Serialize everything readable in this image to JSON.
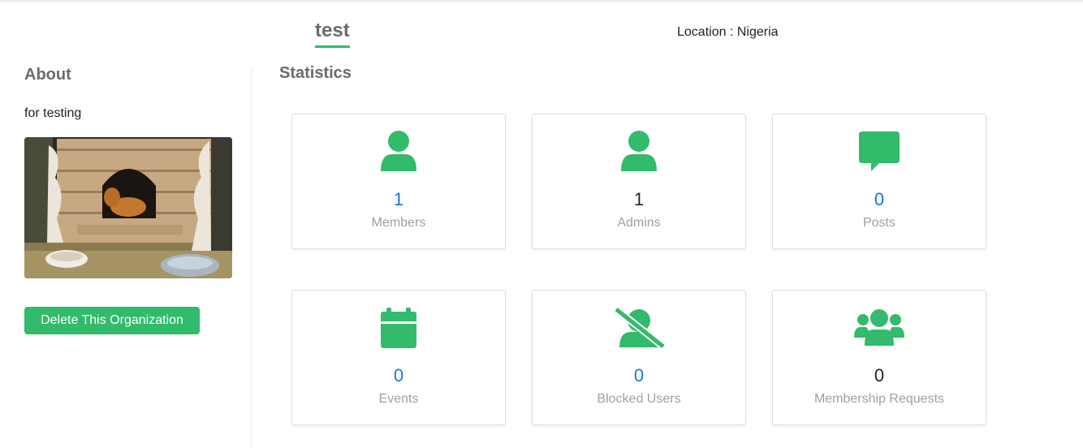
{
  "header": {
    "org_name": "test",
    "location": "Location : Nigeria"
  },
  "about": {
    "heading": "About",
    "description": "for testing",
    "delete_button": "Delete This Organization"
  },
  "statistics": {
    "heading": "Statistics",
    "cards": [
      {
        "icon": "user-icon",
        "value": "1",
        "label": "Members"
      },
      {
        "icon": "user-icon",
        "value": "1",
        "label": "Admins"
      },
      {
        "icon": "comment-icon",
        "value": "0",
        "label": "Posts"
      },
      {
        "icon": "calendar-icon",
        "value": "0",
        "label": "Events"
      },
      {
        "icon": "user-slash-icon",
        "value": "0",
        "label": "Blocked Users"
      },
      {
        "icon": "users-icon",
        "value": "0",
        "label": "Membership Requests"
      }
    ]
  },
  "colors": {
    "accent": "#31bb6b",
    "link": "#1a73e8"
  }
}
